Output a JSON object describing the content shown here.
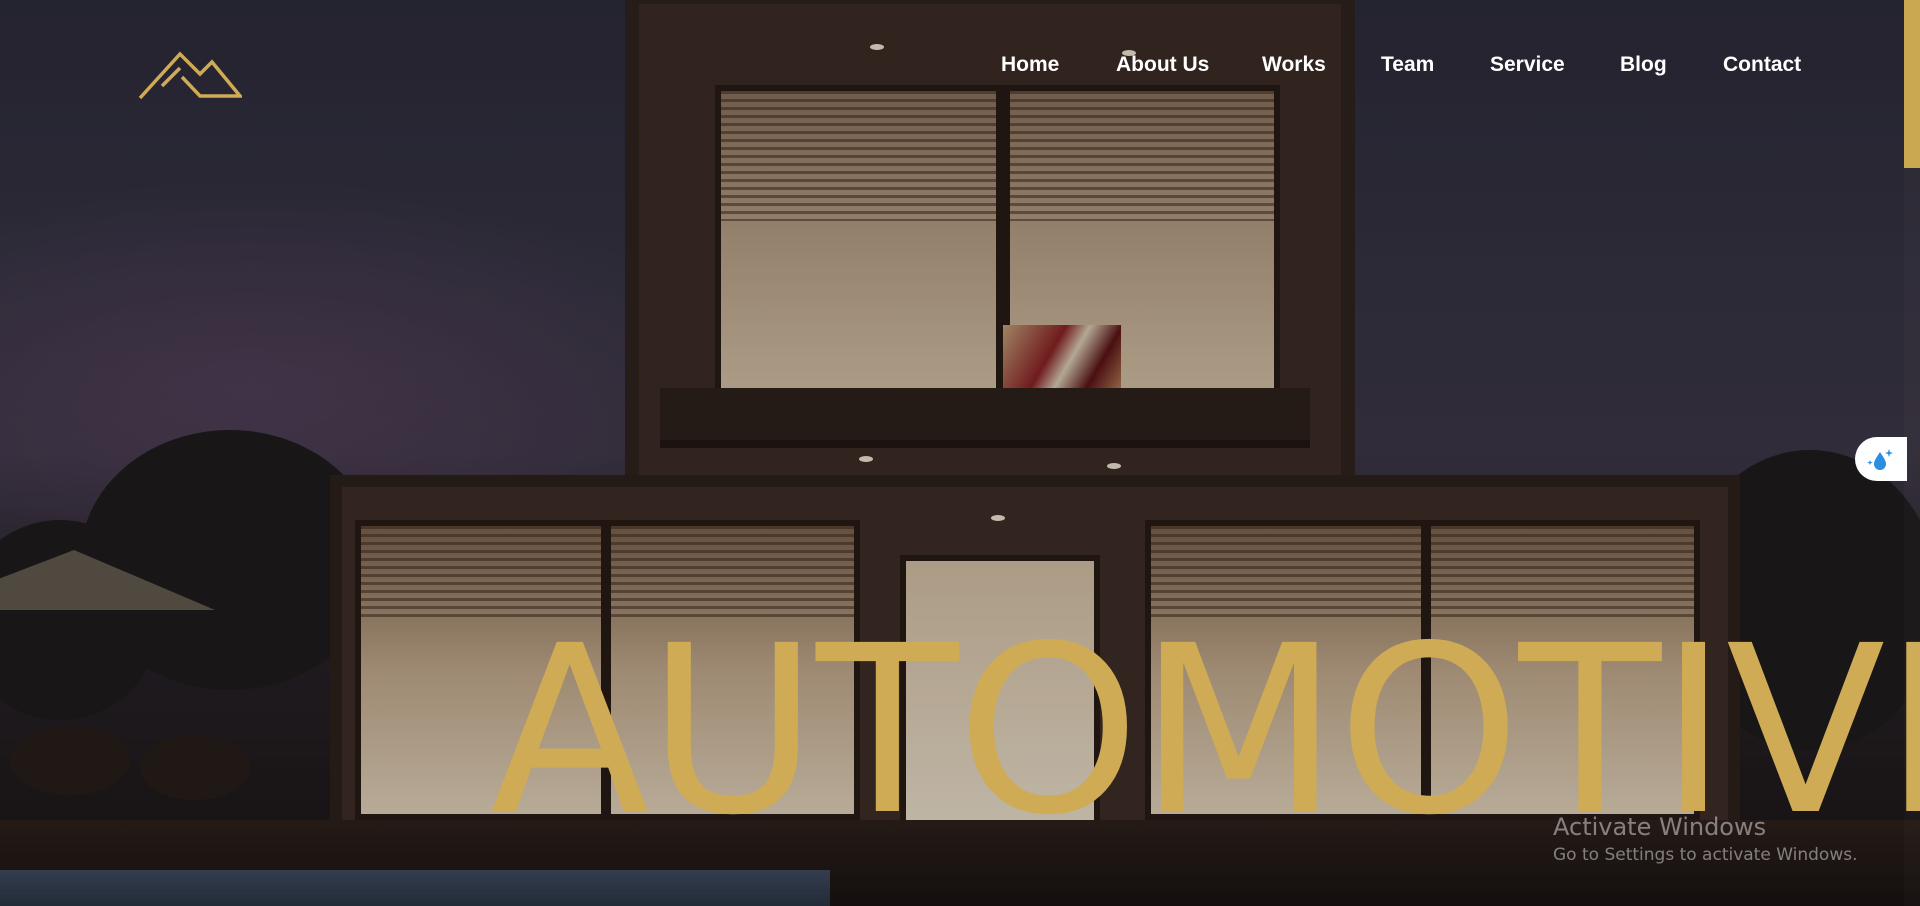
{
  "header": {
    "logo_icon": "mountain-peaks-icon",
    "nav": [
      {
        "label": "Home"
      },
      {
        "label": "About Us"
      },
      {
        "label": "Works"
      },
      {
        "label": "Team"
      },
      {
        "label": "Service"
      },
      {
        "label": "Blog"
      },
      {
        "label": "Contact"
      }
    ]
  },
  "hero": {
    "headline": "AUTOMOTIVE",
    "background_image": "modern-house-at-dusk"
  },
  "side_widget": {
    "icon": "water-drop-sparkle-icon"
  },
  "os_watermark": {
    "title": "Activate Windows",
    "subtitle": "Go to Settings to activate Windows."
  },
  "colors": {
    "accent": "#cfab55",
    "nav_text": "#ffffff",
    "scroll_thumb": "#c9a850"
  }
}
